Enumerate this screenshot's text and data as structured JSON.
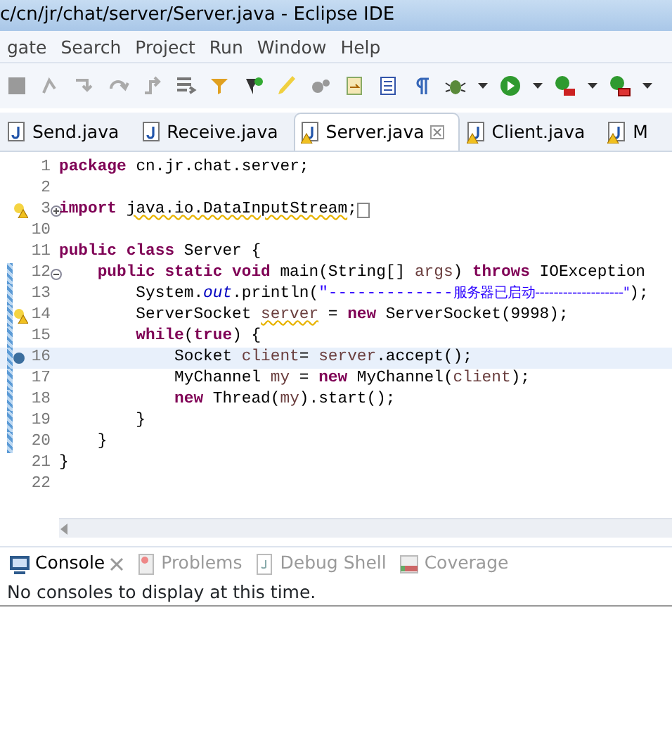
{
  "window": {
    "title": "c/cn/jr/chat/server/Server.java - Eclipse IDE"
  },
  "menu": [
    "gate",
    "Search",
    "Project",
    "Run",
    "Window",
    "Help"
  ],
  "editor_tabs": [
    {
      "label": "Send.java",
      "selected": false,
      "warning": false
    },
    {
      "label": "Receive.java",
      "selected": false,
      "warning": false
    },
    {
      "label": "Server.java",
      "selected": true,
      "warning": true
    },
    {
      "label": "Client.java",
      "selected": false,
      "warning": true
    },
    {
      "label": "M",
      "selected": false,
      "warning": true
    }
  ],
  "code_lines": [
    {
      "number": "1",
      "warning": false,
      "breakpoint": false,
      "folded": false,
      "collapsible": false,
      "changed": false,
      "current": false,
      "tokens": [
        {
          "text": "package",
          "kind": "keyword"
        },
        {
          "text": " cn.jr.chat.server;",
          "kind": "plain"
        }
      ]
    },
    {
      "number": "2",
      "warning": false,
      "breakpoint": false,
      "folded": false,
      "collapsible": false,
      "changed": false,
      "current": false
    },
    {
      "number": "3",
      "warning": true,
      "breakpoint": false,
      "folded": true,
      "collapsible": false,
      "changed": false,
      "current": false,
      "tokens": [
        {
          "text": "import ",
          "kind": "keyword"
        },
        {
          "text": "java.io.DataInputStream",
          "kind": "plain-warning"
        },
        {
          "text": ";",
          "kind": "plain"
        }
      ]
    },
    {
      "number": "10",
      "warning": false,
      "breakpoint": false,
      "folded": false,
      "collapsible": false,
      "changed": false,
      "current": false
    },
    {
      "number": "11",
      "warning": false,
      "breakpoint": false,
      "folded": false,
      "collapsible": false,
      "changed": false,
      "current": false,
      "tokens": [
        {
          "text": "public class",
          "kind": "keyword"
        },
        {
          "text": " Server {",
          "kind": "plain"
        }
      ]
    },
    {
      "number": "12",
      "warning": false,
      "breakpoint": false,
      "folded": false,
      "collapsible": true,
      "changed": true,
      "current": false,
      "tokens": [
        {
          "text": "    public static void",
          "kind": "keyword"
        },
        {
          "text": " main(String[] ",
          "kind": "plain"
        },
        {
          "text": "args",
          "kind": "local"
        },
        {
          "text": ") ",
          "kind": "plain"
        },
        {
          "text": "throws",
          "kind": "keyword"
        },
        {
          "text": " IOException",
          "kind": "plain"
        }
      ]
    },
    {
      "number": "13",
      "warning": false,
      "breakpoint": false,
      "folded": false,
      "collapsible": false,
      "changed": true,
      "current": false,
      "tokens": [
        {
          "text": "        System.",
          "kind": "plain"
        },
        {
          "text": "out",
          "kind": "field"
        },
        {
          "text": ".println(",
          "kind": "plain"
        },
        {
          "text": "\"-------------",
          "kind": "string"
        },
        {
          "text": "服务器已启动-------------------\"",
          "kind": "string-small"
        },
        {
          "text": ");",
          "kind": "plain"
        }
      ]
    },
    {
      "number": "14",
      "warning": true,
      "breakpoint": false,
      "folded": false,
      "collapsible": false,
      "changed": true,
      "current": false,
      "tokens": [
        {
          "text": "        ServerSocket ",
          "kind": "plain"
        },
        {
          "text": "server",
          "kind": "local-warning"
        },
        {
          "text": " = ",
          "kind": "plain"
        },
        {
          "text": "new",
          "kind": "keyword"
        },
        {
          "text": " ServerSocket(9998);",
          "kind": "plain"
        }
      ]
    },
    {
      "number": "15",
      "warning": false,
      "breakpoint": false,
      "folded": false,
      "collapsible": false,
      "changed": true,
      "current": false,
      "tokens": [
        {
          "text": "        while",
          "kind": "keyword"
        },
        {
          "text": "(",
          "kind": "plain"
        },
        {
          "text": "true",
          "kind": "keyword"
        },
        {
          "text": ") {",
          "kind": "plain"
        }
      ]
    },
    {
      "number": "16",
      "warning": false,
      "breakpoint": true,
      "folded": false,
      "collapsible": false,
      "changed": true,
      "current": true,
      "tokens": [
        {
          "text": "            Socket ",
          "kind": "plain"
        },
        {
          "text": "client",
          "kind": "local"
        },
        {
          "text": "= ",
          "kind": "plain"
        },
        {
          "text": "server",
          "kind": "local"
        },
        {
          "text": ".accept();",
          "kind": "plain"
        }
      ]
    },
    {
      "number": "17",
      "warning": false,
      "breakpoint": false,
      "folded": false,
      "collapsible": false,
      "changed": true,
      "current": false,
      "tokens": [
        {
          "text": "            MyChannel ",
          "kind": "plain"
        },
        {
          "text": "my",
          "kind": "local"
        },
        {
          "text": " = ",
          "kind": "plain"
        },
        {
          "text": "new",
          "kind": "keyword"
        },
        {
          "text": " MyChannel(",
          "kind": "plain"
        },
        {
          "text": "client",
          "kind": "local"
        },
        {
          "text": ");",
          "kind": "plain"
        }
      ]
    },
    {
      "number": "18",
      "warning": false,
      "breakpoint": false,
      "folded": false,
      "collapsible": false,
      "changed": true,
      "current": false,
      "tokens": [
        {
          "text": "            new",
          "kind": "keyword"
        },
        {
          "text": " Thread(",
          "kind": "plain"
        },
        {
          "text": "my",
          "kind": "local"
        },
        {
          "text": ").start();",
          "kind": "plain"
        }
      ]
    },
    {
      "number": "19",
      "warning": false,
      "breakpoint": false,
      "folded": false,
      "collapsible": false,
      "changed": true,
      "current": false,
      "tokens": [
        {
          "text": "        }",
          "kind": "plain"
        }
      ]
    },
    {
      "number": "20",
      "warning": false,
      "breakpoint": false,
      "folded": false,
      "collapsible": false,
      "changed": true,
      "current": false,
      "tokens": [
        {
          "text": "    }",
          "kind": "plain"
        }
      ]
    },
    {
      "number": "21",
      "warning": false,
      "breakpoint": false,
      "folded": false,
      "collapsible": false,
      "changed": false,
      "current": false,
      "tokens": [
        {
          "text": "}",
          "kind": "plain"
        }
      ]
    },
    {
      "number": "22",
      "warning": false,
      "breakpoint": false,
      "folded": false,
      "collapsible": false,
      "changed": false,
      "current": false
    }
  ],
  "panel_tabs": [
    {
      "label": "Console",
      "selected": true,
      "kind": "console"
    },
    {
      "label": "Problems",
      "selected": false,
      "kind": "problems"
    },
    {
      "label": "Debug Shell",
      "selected": false,
      "kind": "debug"
    },
    {
      "label": "Coverage",
      "selected": false,
      "kind": "coverage"
    }
  ],
  "console_message": "No consoles to display at this time."
}
